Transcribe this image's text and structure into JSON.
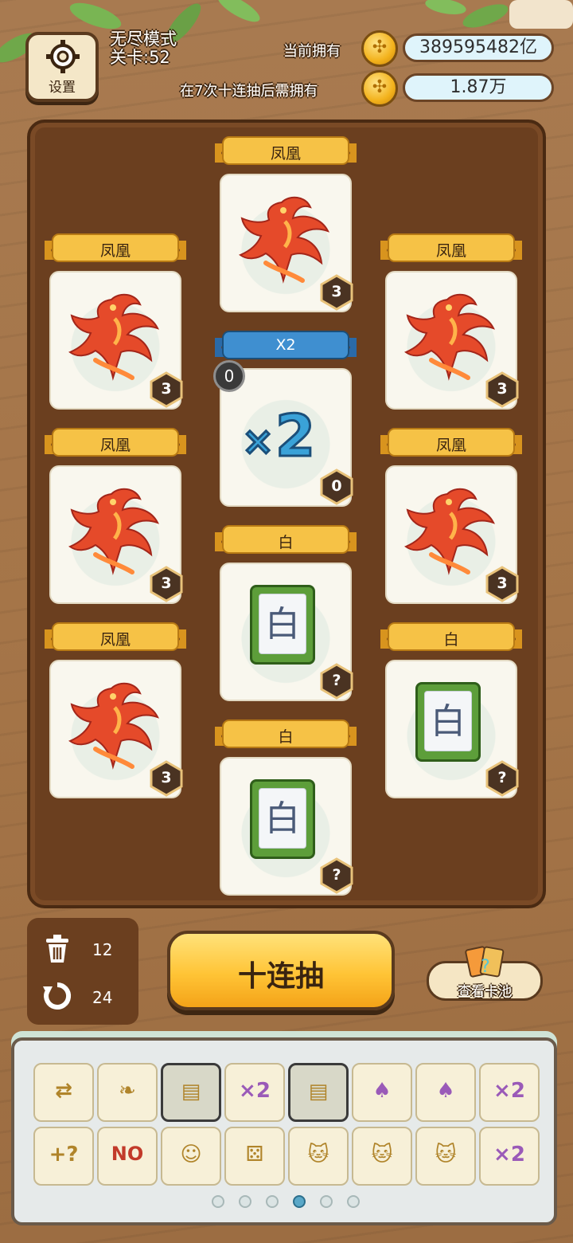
{
  "header": {
    "settings_label": "设置",
    "mode": "无尽模式",
    "level": "关卡:52",
    "owned_label": "当前拥有",
    "owned_value": "389595482亿",
    "required_label": "在7次十连抽后需拥有",
    "required_value": "1.87万"
  },
  "cards": [
    {
      "name": "凤凰",
      "count": "3",
      "type": "phoenix"
    },
    {
      "name": "凤凰",
      "count": "3",
      "type": "phoenix"
    },
    {
      "name": "凤凰",
      "count": "3",
      "type": "phoenix"
    },
    {
      "name": "X2",
      "count": "0",
      "extra": "0",
      "type": "x2"
    },
    {
      "name": "凤凰",
      "count": "3",
      "type": "phoenix"
    },
    {
      "name": "凤凰",
      "count": "3",
      "type": "phoenix"
    },
    {
      "name": "白",
      "count": "?",
      "type": "tile",
      "glyph": "白"
    },
    {
      "name": "凤凰",
      "count": "3",
      "type": "phoenix"
    },
    {
      "name": "白",
      "count": "?",
      "type": "tile",
      "glyph": "白"
    },
    {
      "name": "白",
      "count": "?",
      "type": "tile",
      "glyph": "白"
    }
  ],
  "controls": {
    "trash_count": "12",
    "refresh_count": "24",
    "draw_label": "十连抽",
    "pool_label": "查看卡池"
  },
  "inventory": {
    "items": [
      "card-swap",
      "feather",
      "scroll",
      "phoenix-cards-x2",
      "scroll",
      "phoenix-cards",
      "phoenix-cards",
      "phoenix-cards-x2",
      "add-card",
      "no-stamp",
      "hero-group",
      "dice",
      "lucky-cat",
      "lucky-cat",
      "lucky-cat",
      "phoenix-cards-x2"
    ],
    "page_count": 6,
    "active_page": 4
  },
  "colors": {
    "wood": "#a87a50",
    "board": "#6b3f1f",
    "accent": "#ffc436",
    "ribbon": "#f6c246",
    "x2_ribbon": "#3f8fd0"
  }
}
